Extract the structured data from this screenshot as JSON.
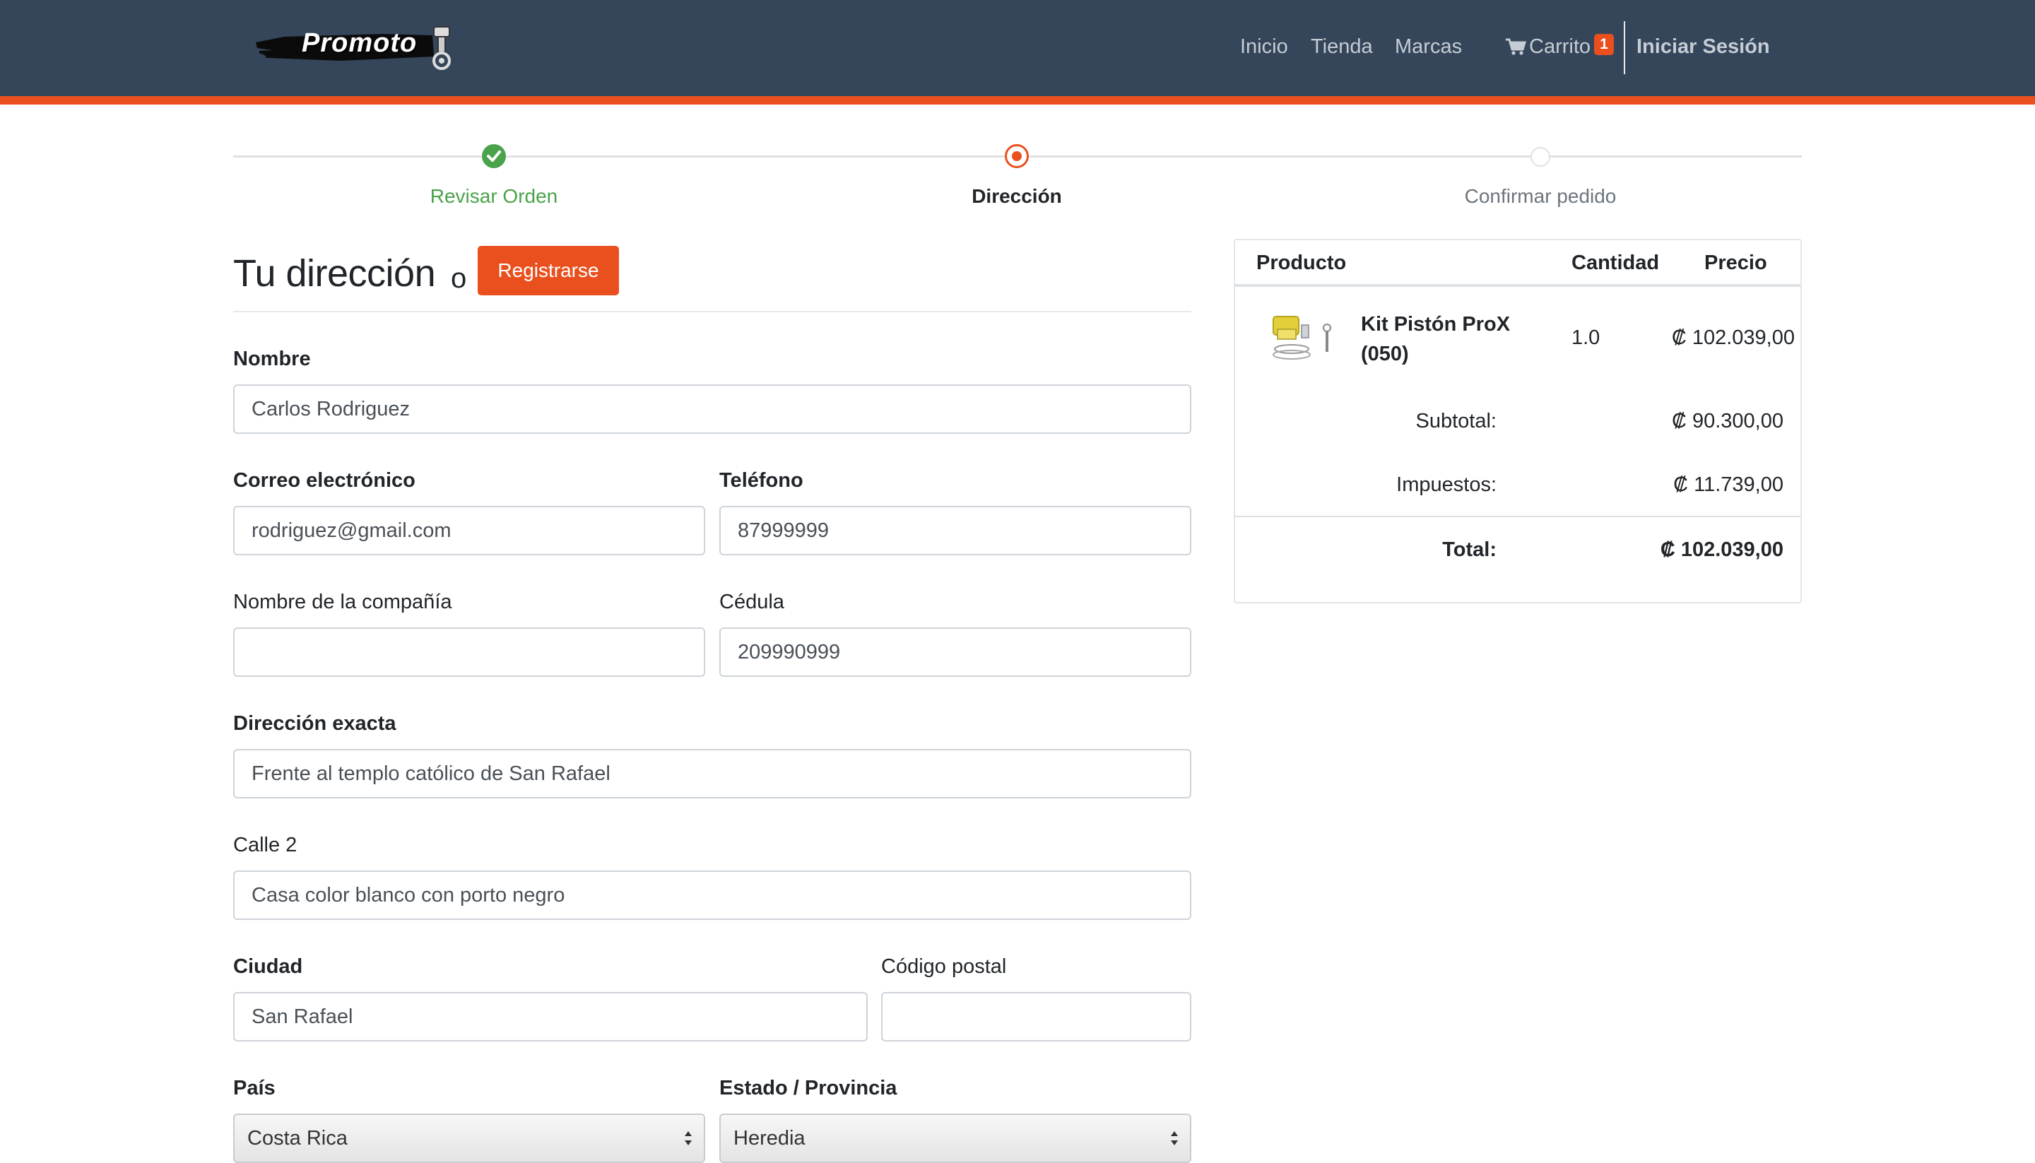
{
  "brand": {
    "name": "Promoto"
  },
  "nav": {
    "links": [
      "Inicio",
      "Tienda",
      "Marcas"
    ],
    "cart_label": "Carrito",
    "cart_count": "1",
    "login_label": "Iniciar Sesión"
  },
  "stepper": {
    "steps": [
      {
        "label": "Revisar Orden",
        "state": "done"
      },
      {
        "label": "Dirección",
        "state": "active"
      },
      {
        "label": "Confirmar pedido",
        "state": "pending"
      }
    ],
    "colors": {
      "done": "#4aa34a",
      "active": "#e9501d",
      "pending": "#dee2e6"
    }
  },
  "form": {
    "title": "Tu dirección",
    "or_text": "o",
    "register_label": "Registrarse",
    "fields": {
      "nombre": {
        "label": "Nombre",
        "value": "Carlos Rodriguez"
      },
      "correo": {
        "label": "Correo electrónico",
        "value": "rodriguez@gmail.com"
      },
      "telefono": {
        "label": "Teléfono",
        "value": "87999999"
      },
      "compania": {
        "label": "Nombre de la compañía",
        "value": ""
      },
      "cedula": {
        "label": "Cédula",
        "value": "209990999"
      },
      "direccion": {
        "label": "Dirección exacta",
        "value": "Frente al templo católico de San Rafael"
      },
      "calle2": {
        "label": "Calle 2",
        "value": "Casa color blanco con porto negro"
      },
      "ciudad": {
        "label": "Ciudad",
        "value": "San Rafael"
      },
      "postal": {
        "label": "Código postal",
        "value": ""
      },
      "pais": {
        "label": "País",
        "value": "Costa Rica"
      },
      "estado": {
        "label": "Estado / Provincia",
        "value": "Heredia"
      }
    }
  },
  "summary": {
    "headers": {
      "product": "Producto",
      "quantity": "Cantidad",
      "price": "Precio"
    },
    "items": [
      {
        "name": "Kit Pistón ProX (050)",
        "quantity": "1.0",
        "price": "₡ 102.039,00"
      }
    ],
    "subtotal_label": "Subtotal:",
    "subtotal": "₡ 90.300,00",
    "taxes_label": "Impuestos:",
    "taxes": "₡ 11.739,00",
    "total_label": "Total:",
    "total": "₡ 102.039,00"
  },
  "colors": {
    "navbar": "#35465a",
    "accent": "#e9501d",
    "success": "#4aa34a"
  }
}
